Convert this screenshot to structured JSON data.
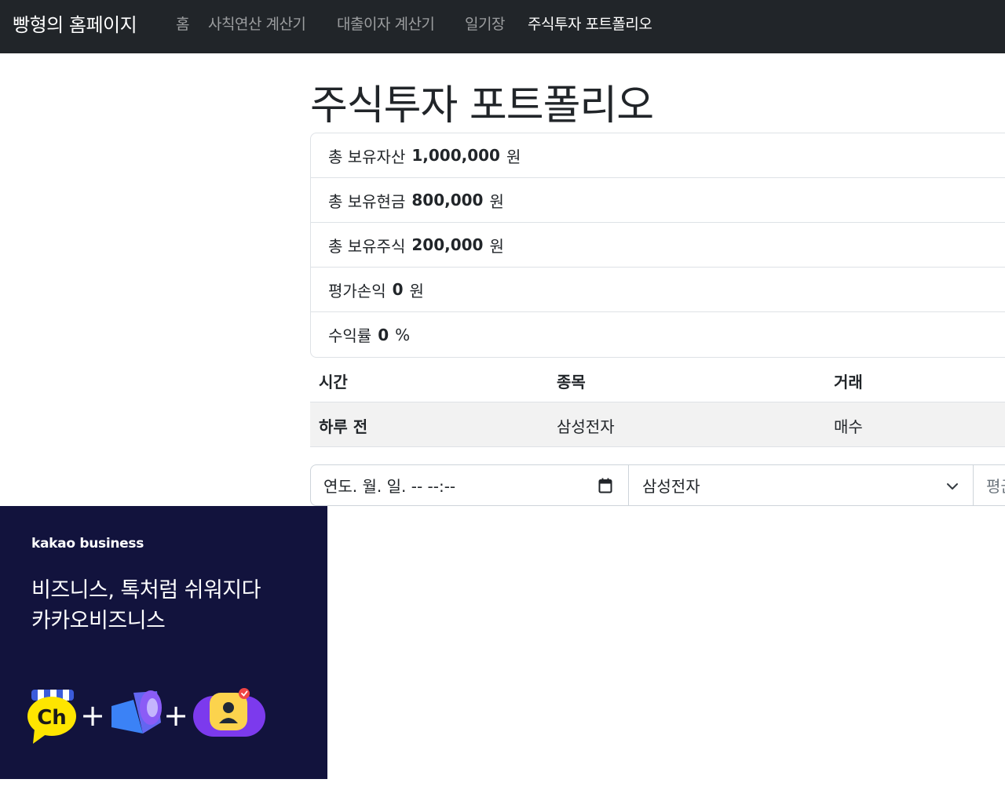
{
  "nav": {
    "brand": "빵형의 홈페이지",
    "links": [
      "홈",
      "사칙연산 계산기",
      "대출이자 계산기",
      "일기장",
      "주식투자 포트폴리오"
    ]
  },
  "page": {
    "title": "주식투자 포트폴리오"
  },
  "summary": [
    {
      "label": "총 보유자산",
      "value": "1,000,000",
      "unit": "원"
    },
    {
      "label": "총 보유현금",
      "value": "800,000",
      "unit": "원"
    },
    {
      "label": "총 보유주식",
      "value": "200,000",
      "unit": "원"
    },
    {
      "label": "평가손익",
      "value": "0",
      "unit": "원"
    },
    {
      "label": "수익률",
      "value": "0",
      "unit": "%"
    }
  ],
  "table": {
    "headers": [
      "시간",
      "종목",
      "거래"
    ],
    "rows": [
      {
        "time": "하루 전",
        "stock": "삼성전자",
        "trade": "매수"
      }
    ]
  },
  "form": {
    "datetime_placeholder": "연도. 월. 일. -- --:--",
    "stock_selected": "삼성전자",
    "third_placeholder": "평균"
  },
  "ad": {
    "brand": "kakao business",
    "headline_line1": "비즈니스, 톡처럼 쉬워지다",
    "headline_line2": "카카오비즈니스",
    "icon_text": "Ch"
  },
  "colors": {
    "navbar": "#212529",
    "ad_background": "#12133d",
    "ch_yellow": "#fee500",
    "accent_purple": "#7c3aed"
  }
}
